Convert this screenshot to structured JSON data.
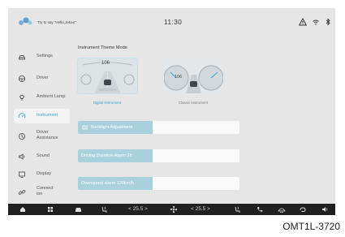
{
  "status_bar": {
    "voice_hint": "Try to say \"Hello,Jetour\"",
    "time": "11:30",
    "icons": [
      "warning-triangle-icon",
      "wifi-icon",
      "bluetooth-icon"
    ]
  },
  "sidebar": {
    "items": [
      {
        "label": "Settings",
        "icon": "car-icon",
        "active": false
      },
      {
        "label": "Driver",
        "icon": "steering-wheel-icon",
        "active": false
      },
      {
        "label": "Ambient Lamp",
        "icon": "lamp-icon",
        "active": false
      },
      {
        "label": "Instrument",
        "icon": "instrument-gauge-icon",
        "active": true
      },
      {
        "label": "Driver\nAssistance",
        "icon": "assistance-icon",
        "active": false
      },
      {
        "label": "Sound",
        "icon": "speaker-icon",
        "active": false
      },
      {
        "label": "Display",
        "icon": "display-icon",
        "active": false
      },
      {
        "label": "Connect\nion",
        "icon": "link-icon",
        "active": false
      }
    ]
  },
  "main": {
    "section_title": "Instrument Theme Mode",
    "themes": [
      {
        "caption": "Digital Instrument",
        "selected": true,
        "speed": "106"
      },
      {
        "caption": "Classic Instrument",
        "selected": false,
        "speed": "106"
      }
    ],
    "settings": [
      {
        "label": "Backlight Adjustment",
        "level": 0.46,
        "has_icon": true
      },
      {
        "label": "Driving Duration Alarm  2h",
        "level": 0.46,
        "has_icon": false
      },
      {
        "label": "Overspeed alarm  120km/h",
        "level": 0.46,
        "has_icon": false
      }
    ]
  },
  "bottom_bar": {
    "left_temp": "< 25.5 >",
    "right_temp": "< 25.5 >",
    "icons": [
      "home-icon",
      "apps-grid-icon",
      "car-icon",
      "seat-heat-icon",
      "fan-icon",
      "seat-heat-icon",
      "phone-icon",
      "defrost-icon",
      "recirculation-icon",
      "volume-icon"
    ]
  },
  "figure_label": "OMT1L-3720",
  "colors": {
    "accent": "#3aa6c4",
    "bar_fill": "#a8d1dc",
    "screen_bg": "#e6e6e6",
    "bottom_bar": "#202020"
  }
}
